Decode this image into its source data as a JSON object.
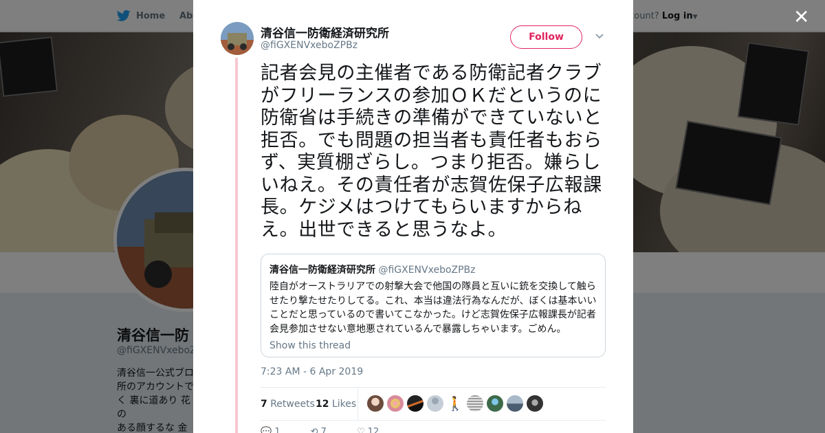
{
  "nav": {
    "home": "Home",
    "about": "Abo",
    "login_prefix": "account? ",
    "login": "Log in"
  },
  "profile": {
    "name": "清谷信一防",
    "handle": "@fiGXENVxeboZPI",
    "bio": "清谷信一公式ブロ\n所のアカウントで\nく 裏に道あり 花の\nある顔するな 金か\nな」 タイトルの"
  },
  "tweet": {
    "author_name": "清谷信一防衛経済研究所",
    "author_handle": "@fiGXENVxeboZPBz",
    "follow_label": "Follow",
    "text": "記者会見の主催者である防衛記者クラブがフリーランスの参加ＯＫだというのに防衛省は手続きの準備ができていないと拒否。でも問題の担当者も責任者もおらず、実質棚ざらし。つまり拒否。嫌らしいねえ。その責任者が志賀佐保子広報課長。ケジメはつけてもらいますからねえ。出世できると思うなよ。",
    "timestamp": "7:23 AM - 6 Apr 2019",
    "retweets_count": "7",
    "retweets_label": "Retweets",
    "likes_count": "12",
    "likes_label": "Likes",
    "actions": {
      "reply": "1",
      "retweet": "7",
      "like": "12"
    }
  },
  "quote": {
    "author_name": "清谷信一防衛経済研究所",
    "author_handle": "@fiGXENVxeboZPBz",
    "text": "陸自がオーストラリアでの射撃大会で他国の隊員と互いに銃を交換して触らせたり撃たせたりしてる。これ、本当は違法行為なんだが、ぼくは基本いいことだと思っているので書いてこなかった。けど志賀佐保子広報課長が記者会見参加させない意地悪されているんで暴露しちゃいます。ごめん。",
    "show_thread": "Show this thread"
  },
  "colors": {
    "accent": "#e0245e",
    "thread_line": "#f7c7d0",
    "link_gray": "#657786",
    "text": "#14171a"
  }
}
